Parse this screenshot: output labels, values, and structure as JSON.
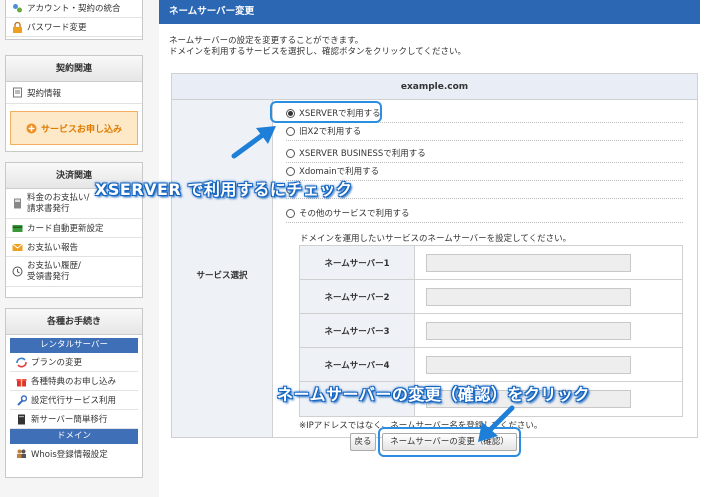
{
  "sidebar": {
    "top_items": [
      {
        "icon": "account-link-icon",
        "label": "アカウント・契約の統合"
      },
      {
        "icon": "lock-icon",
        "label": "パスワード変更"
      }
    ],
    "contract": {
      "title": "契約関連",
      "info": "契約情報",
      "apply": "サービスお申し込み"
    },
    "payment": {
      "title": "決済関連",
      "items": [
        {
          "icon": "calculator-icon",
          "label": "料金のお支払い/\n請求書発行"
        },
        {
          "icon": "credit-card-icon",
          "label": "カード自動更新設定"
        },
        {
          "icon": "envelope-icon",
          "label": "お支払い報告"
        },
        {
          "icon": "history-icon",
          "label": "お支払い履歴/\n受領書発行"
        }
      ]
    },
    "procedures": {
      "title": "各種お手続き",
      "rental_header": "レンタルサーバー",
      "rental_items": [
        {
          "icon": "plan-change-icon",
          "label": "プランの変更"
        },
        {
          "icon": "gift-icon",
          "label": "各種特典のお申し込み"
        },
        {
          "icon": "wrench-icon",
          "label": "設定代行サービス利用"
        },
        {
          "icon": "server-icon",
          "label": "新サーバー簡単移行"
        }
      ],
      "domain_header": "ドメイン",
      "domain_items": [
        {
          "icon": "people-icon",
          "label": "Whois登録情報設定"
        }
      ]
    }
  },
  "main": {
    "title": "ネームサーバー変更",
    "desc1": "ネームサーバーの設定を変更することができます。",
    "desc2": "ドメインを利用するサービスを選択し、確認ボタンをクリックしてください。",
    "domain": "example.com",
    "service_label": "サービス選択",
    "options": [
      "XSERVERで利用する",
      "旧X2で利用する",
      "XSERVER BUSINESSで利用する",
      "Xdomainで利用する",
      "",
      "その他のサービスで利用する"
    ],
    "selected_index": 0,
    "ns_note": "ドメインを運用したいサービスのネームサーバーを設定してください。",
    "ns_labels": [
      "ネームサーバー1",
      "ネームサーバー2",
      "ネームサーバー3",
      "ネームサーバー4"
    ],
    "ip_note": "※IPアドレスではなく、ネームサーバー名を登録してください。",
    "back_button": "戻る",
    "confirm_button": "ネームサーバーの変更（確認）"
  },
  "annotations": {
    "check_xserver": "XSERVER で利用するにチェック",
    "click_confirm": "ネームサーバーの変更（確認）をクリック"
  },
  "colors": {
    "header_blue": "#2b67b3",
    "highlight_blue": "#2b8ee0",
    "apply_orange": "#f08c1e"
  }
}
